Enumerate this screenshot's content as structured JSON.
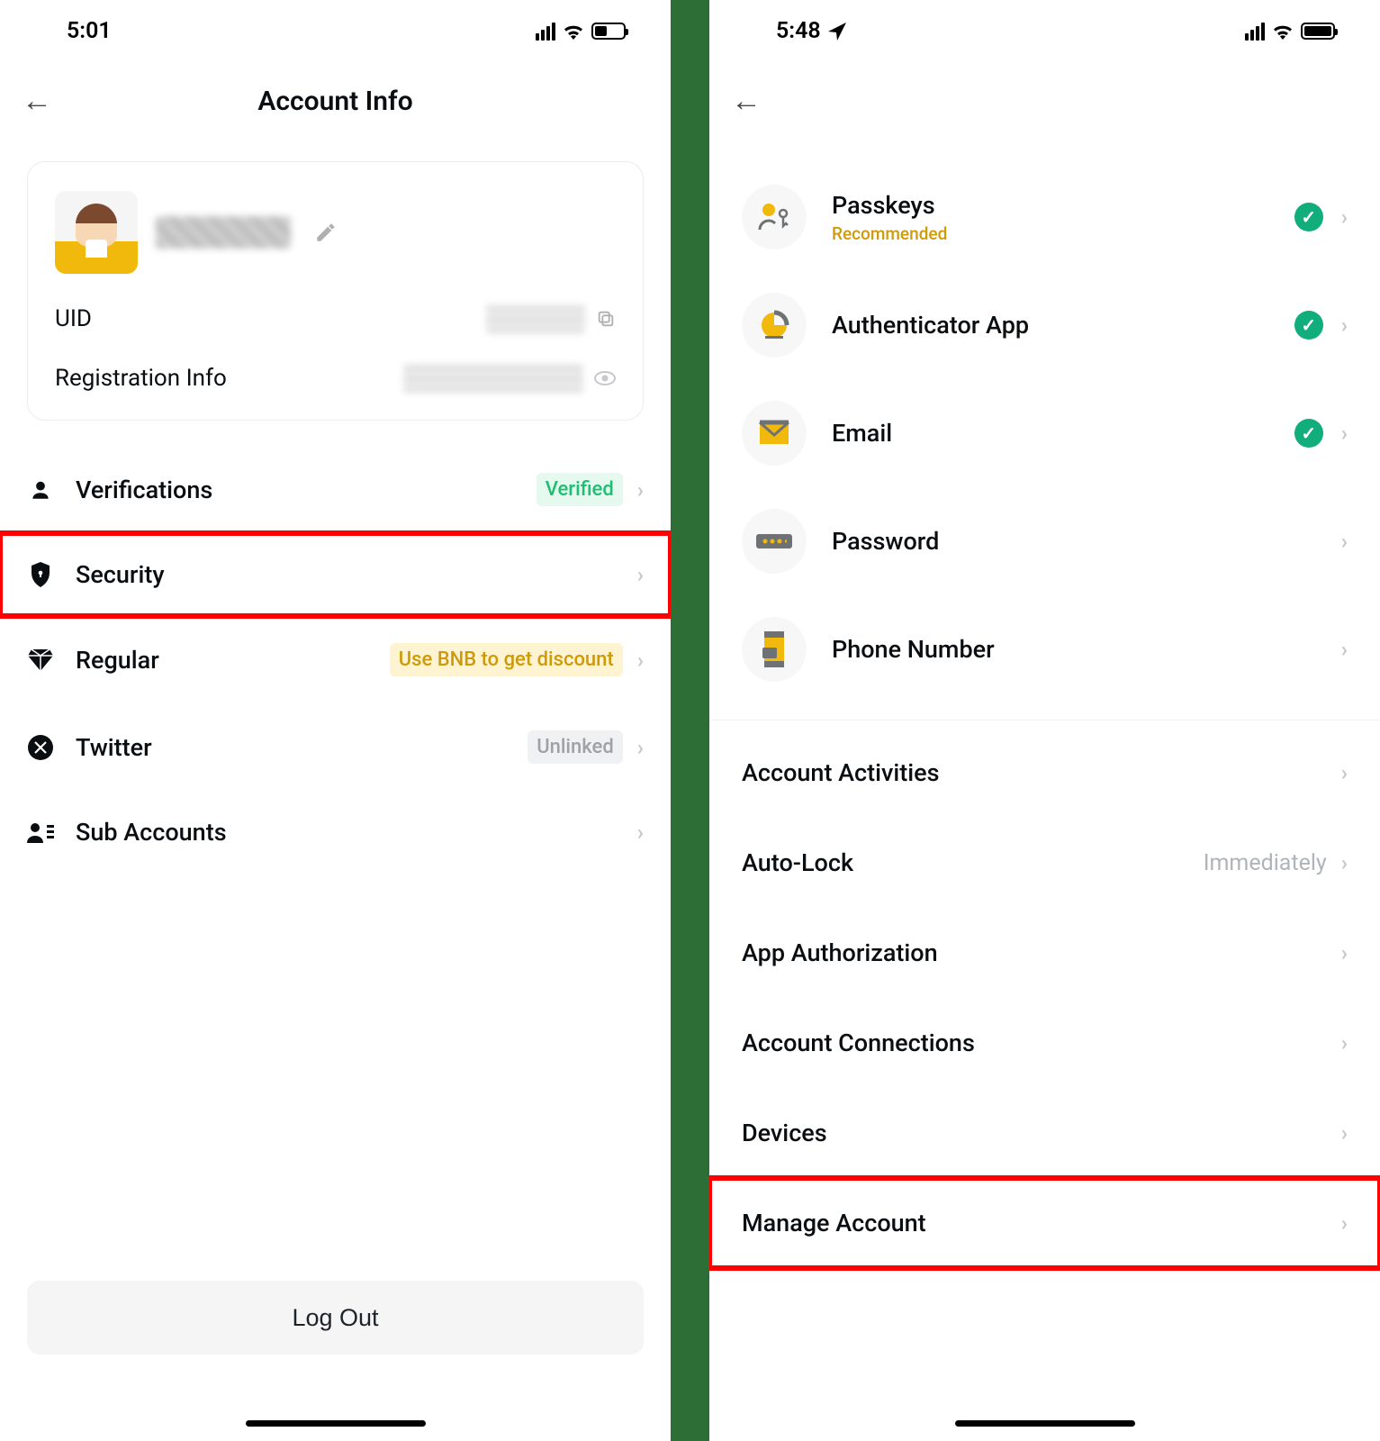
{
  "left": {
    "status": {
      "time": "5:01"
    },
    "header": {
      "title": "Account Info"
    },
    "card": {
      "uid_label": "UID",
      "reg_label": "Registration Info"
    },
    "rows": {
      "verifications": {
        "label": "Verifications",
        "badge": "Verified"
      },
      "security": {
        "label": "Security"
      },
      "regular": {
        "label": "Regular",
        "badge": "Use BNB to get discount"
      },
      "twitter": {
        "label": "Twitter",
        "badge": "Unlinked"
      },
      "sub": {
        "label": "Sub Accounts"
      }
    },
    "logout": "Log Out"
  },
  "right": {
    "status": {
      "time": "5:48"
    },
    "security_items": {
      "passkeys": {
        "title": "Passkeys",
        "sub": "Recommended"
      },
      "authenticator": {
        "title": "Authenticator App"
      },
      "email": {
        "title": "Email"
      },
      "password": {
        "title": "Password"
      },
      "phone": {
        "title": "Phone Number"
      }
    },
    "settings": {
      "activities": "Account Activities",
      "autolock": {
        "label": "Auto-Lock",
        "value": "Immediately"
      },
      "appauth": "App Authorization",
      "connections": "Account Connections",
      "devices": "Devices",
      "manage": "Manage Account"
    }
  }
}
